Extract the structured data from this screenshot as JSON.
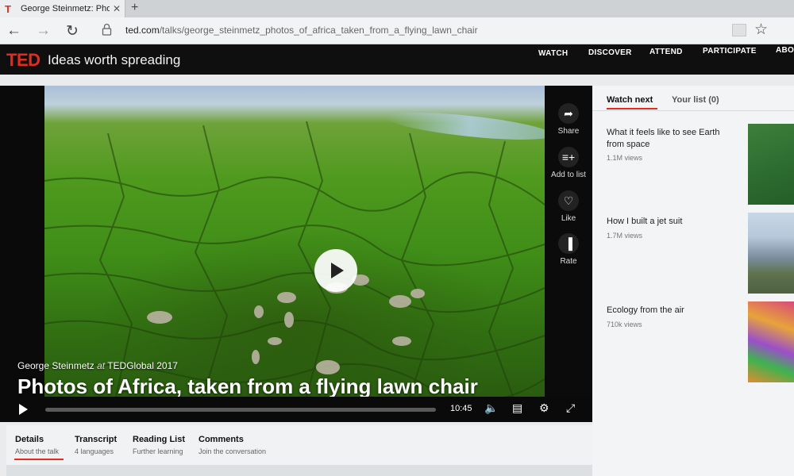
{
  "browser": {
    "tab_title": "George Steinmetz: Phot",
    "tab_favicon": "T",
    "close_glyph": "✕",
    "new_tab_glyph": "+",
    "back_glyph": "←",
    "forward_glyph": "→",
    "refresh_glyph": "↻",
    "star_glyph": "☆",
    "url_domain": "ted.com",
    "url_path": "/talks/george_steinmetz_photos_of_africa_taken_from_a_flying_lawn_chair"
  },
  "ted": {
    "logo": "TED",
    "tagline": "Ideas worth spreading",
    "brand_color": "#e62b1e",
    "nav": [
      "WATCH",
      "DISCOVER",
      "ATTEND",
      "PARTICIPATE",
      "ABOU"
    ]
  },
  "player": {
    "speaker": "George Steinmetz",
    "at": "at",
    "event": "TEDGlobal 2017",
    "title": "Photos of Africa, taken from a flying lawn chair",
    "duration": "10:45",
    "progress": 0.0,
    "actions": [
      {
        "label": "Share",
        "icon": "share-icon",
        "glyph": "➦"
      },
      {
        "label": "Add to list",
        "icon": "add-to-list-icon",
        "glyph": "≡+"
      },
      {
        "label": "Like",
        "icon": "heart-icon",
        "glyph": "♡"
      },
      {
        "label": "Rate",
        "icon": "bar-chart-icon",
        "glyph": "▐"
      }
    ],
    "control_glyphs": {
      "volume": "🔈",
      "captions": "▤",
      "settings": "⚙",
      "fullscreen": "⤢"
    }
  },
  "detail_tabs": [
    {
      "title": "Details",
      "subtitle": "About the talk"
    },
    {
      "title": "Transcript",
      "subtitle": "4 languages"
    },
    {
      "title": "Reading List",
      "subtitle": "Further learning"
    },
    {
      "title": "Comments",
      "subtitle": "Join the conversation"
    }
  ],
  "sidebar": {
    "tabs": [
      "Watch next",
      "Your list (0)"
    ],
    "videos": [
      {
        "title": "What it feels like to see Earth from space",
        "views": "1.1M views"
      },
      {
        "title": "How I built a jet suit",
        "views": "1.7M views"
      },
      {
        "title": "Ecology from the air",
        "views": "710k views"
      }
    ]
  }
}
